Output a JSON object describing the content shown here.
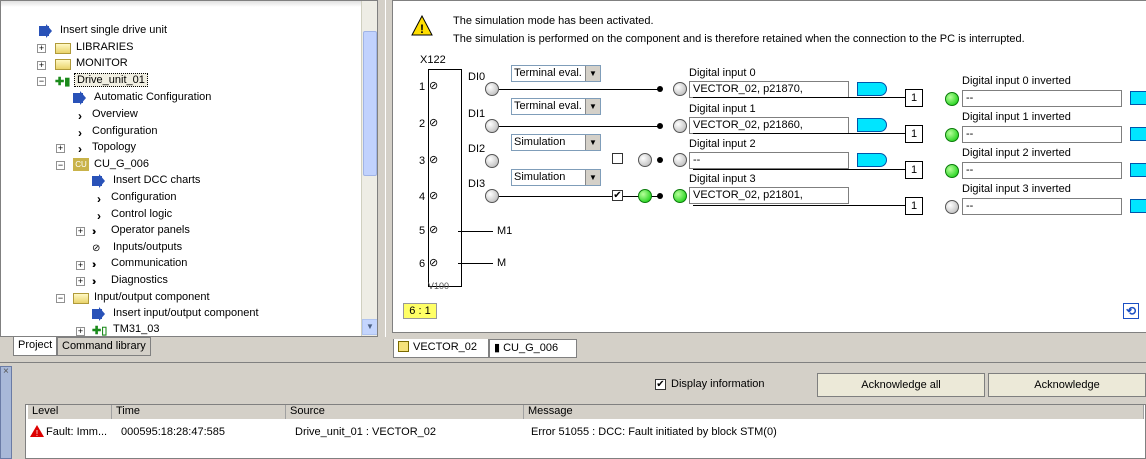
{
  "tree": {
    "items": [
      {
        "label": "Insert single drive unit"
      },
      {
        "label": "LIBRARIES"
      },
      {
        "label": "MONITOR"
      },
      {
        "label": "Drive_unit_01"
      },
      {
        "label": "Automatic Configuration"
      },
      {
        "label": "Overview"
      },
      {
        "label": "Configuration"
      },
      {
        "label": "Topology"
      },
      {
        "label": "CU_G_006"
      },
      {
        "label": "Insert DCC charts"
      },
      {
        "label": "Configuration"
      },
      {
        "label": "Control logic"
      },
      {
        "label": "Operator panels"
      },
      {
        "label": "Inputs/outputs"
      },
      {
        "label": "Communication"
      },
      {
        "label": "Diagnostics"
      },
      {
        "label": "Input/output component"
      },
      {
        "label": "Insert input/output component"
      },
      {
        "label": "TM31_03"
      }
    ],
    "cu_badge": "CU"
  },
  "left_tabs": {
    "project": "Project",
    "command_library": "Command library"
  },
  "diagram": {
    "info_line1": "The simulation mode has been activated.",
    "info_line2": "The simulation is performed on the component and is therefore retained when the connection to the PC is interrupted.",
    "terminal": "X122",
    "pins": [
      "1",
      "2",
      "3",
      "4",
      "5",
      "6"
    ],
    "pin_labels": [
      "DI0",
      "DI1",
      "DI2",
      "DI3",
      "M1",
      "M"
    ],
    "terminal_bottom": "V100",
    "modes": [
      "Terminal eval.",
      "Terminal eval.",
      "Simulation",
      "Simulation"
    ],
    "inputs": [
      {
        "label": "Digital input 0",
        "value": "VECTOR_02, p21870,"
      },
      {
        "label": "Digital input 1",
        "value": "VECTOR_02, p21860,"
      },
      {
        "label": "Digital input 2",
        "value": "--"
      },
      {
        "label": "Digital input 3",
        "value": "VECTOR_02, p21801,"
      }
    ],
    "inverted": [
      {
        "label": "Digital input 0 inverted",
        "value": "--"
      },
      {
        "label": "Digital input 1 inverted",
        "value": "--"
      },
      {
        "label": "Digital input 2 inverted",
        "value": "--"
      },
      {
        "label": "Digital input 3 inverted",
        "value": "--"
      }
    ],
    "not_gate": "1",
    "sim_checks": [
      "",
      "✔"
    ],
    "page_indicator": "6 : 1",
    "tabs": [
      "VECTOR_02",
      "CU_G_006"
    ]
  },
  "messages": {
    "display_information": "Display information",
    "display_checked": "✔",
    "acknowledge_all": "Acknowledge all",
    "acknowledge": "Acknowledge",
    "columns": [
      "Level",
      "Time",
      "Source",
      "Message"
    ],
    "rows": [
      {
        "level": "Fault: Imm...",
        "time": "000595:18:28:47:585",
        "source": "Drive_unit_01 : VECTOR_02",
        "message": "Error 51055 : DCC: Fault initiated by block STM(0)"
      }
    ]
  }
}
